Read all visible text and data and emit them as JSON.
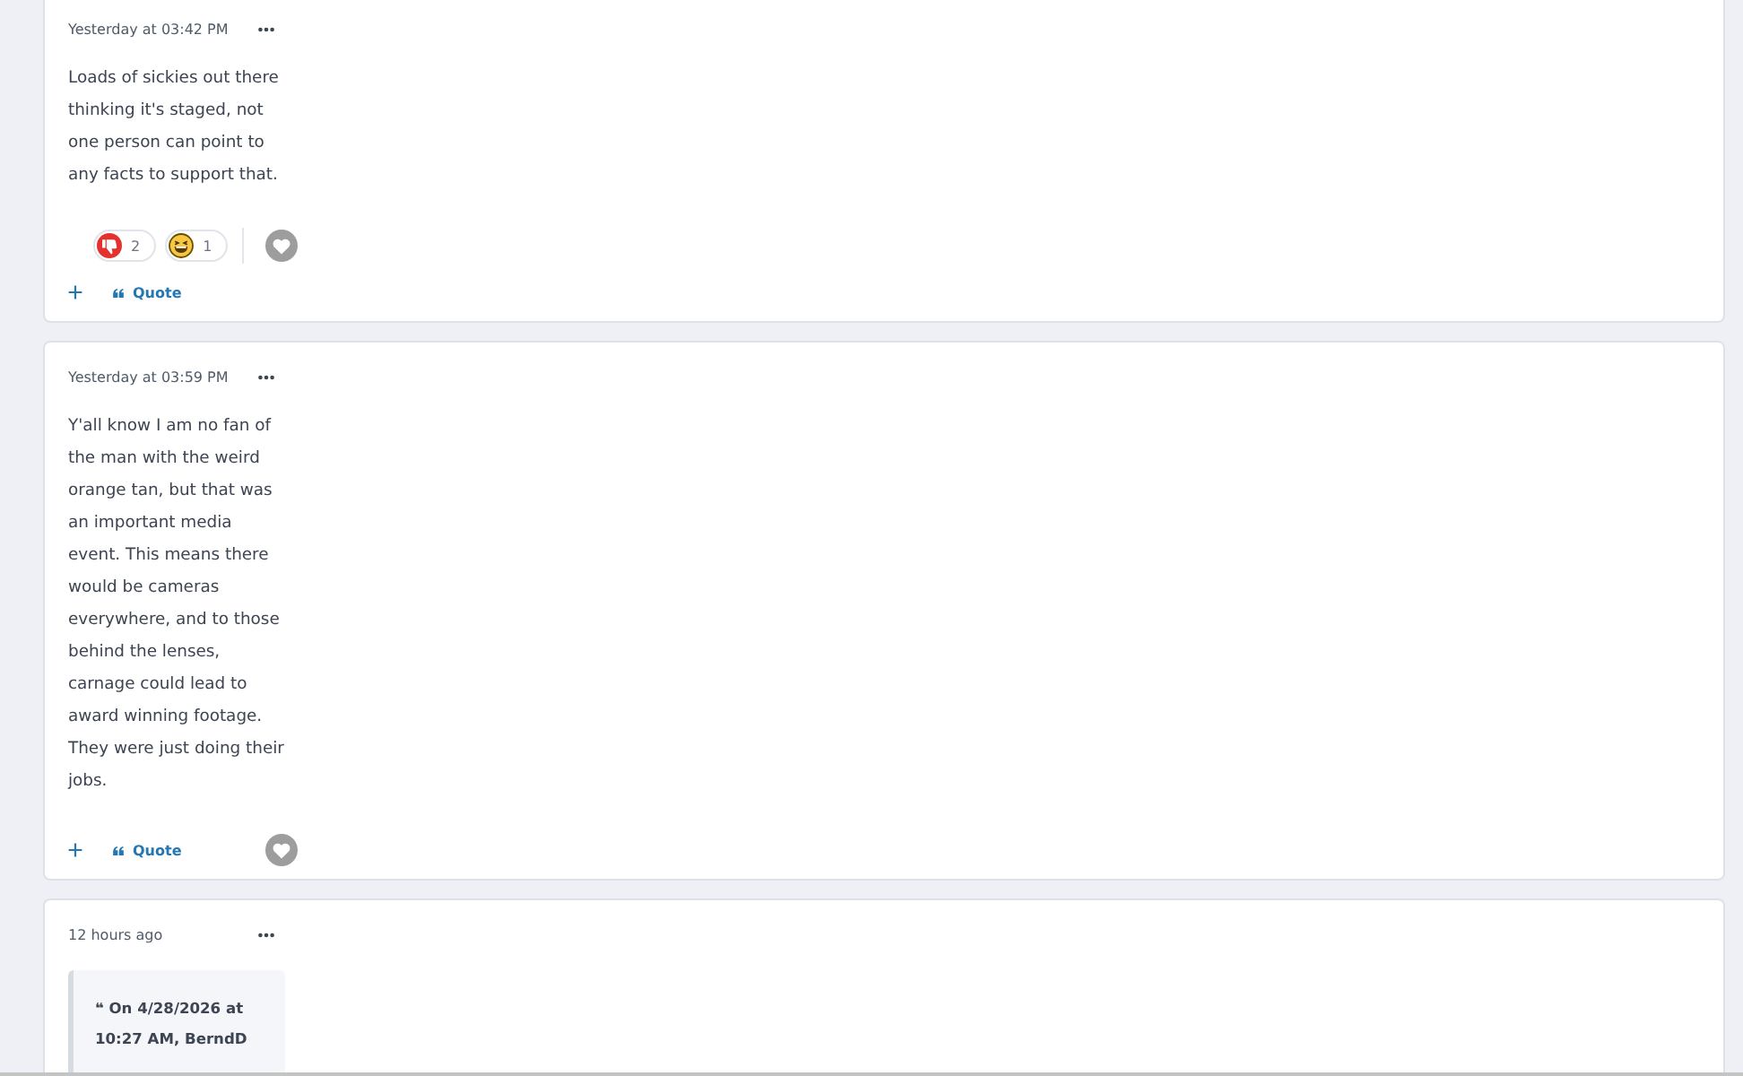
{
  "posts": [
    {
      "timestamp": "Yesterday at 03:42 PM",
      "body": "Loads of sickies out there thinking it's staged, not one person can point to any facts to support that.",
      "reactions": [
        {
          "kind": "dislike",
          "count": "2"
        },
        {
          "kind": "laugh",
          "count": "1"
        }
      ],
      "quote_label": "Quote"
    },
    {
      "timestamp": "Yesterday at 03:59 PM",
      "body": "Y'all know I am no fan of the man with the weird orange tan, but that was an important media event. This means there would be cameras everywhere, and to those behind the lenses, carnage could lead to award winning footage. They were just doing their jobs.",
      "quote_label": "Quote"
    },
    {
      "timestamp": "12 hours ago",
      "quoted": {
        "attribution": "❝ On 4/28/2026 at 10:27 AM, BerndD"
      }
    }
  ]
}
